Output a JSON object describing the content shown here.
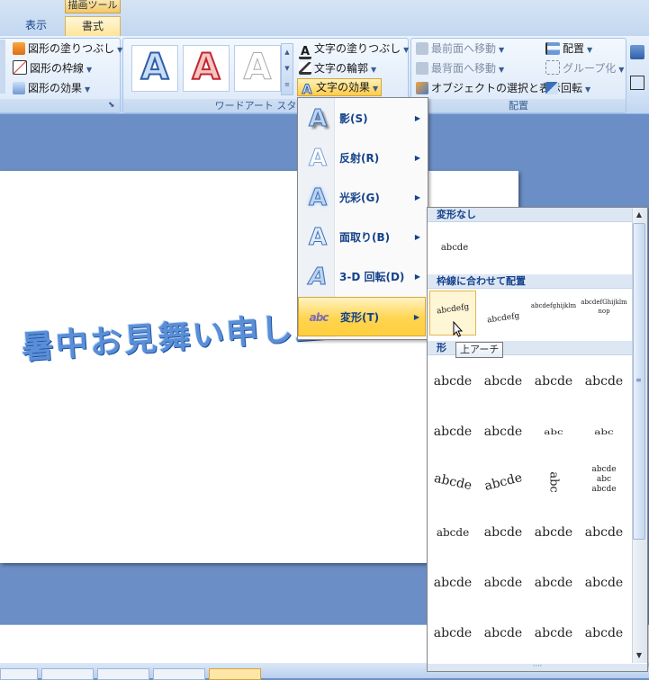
{
  "ribbon": {
    "context_tool_label": "描画ツール",
    "tabs": [
      {
        "label": "表示"
      },
      {
        "label": "書式"
      }
    ],
    "shape_styles": {
      "fill": "図形の塗りつぶし",
      "outline": "図形の枠線",
      "effects": "図形の効果"
    },
    "wordart_styles": {
      "group_label": "ワードアート スタイル",
      "thumb_letter": "A",
      "text_fill": "文字の塗りつぶし",
      "text_outline": "文字の輪郭",
      "text_effects": "文字の効果"
    },
    "arrange": {
      "group_label": "配置",
      "bring_front": "最前面へ移動",
      "send_back": "最背面へ移動",
      "selection_pane": "オブジェクトの選択と表示",
      "align": "配置",
      "group": "グループ化",
      "rotate": "回転"
    }
  },
  "slide": {
    "wordart_text": "暑中お見舞い申し上げ"
  },
  "effects_menu": {
    "items": [
      {
        "label": "影(S)",
        "icon": "shadow-a-icon"
      },
      {
        "label": "反射(R)",
        "icon": "reflection-a-icon"
      },
      {
        "label": "光彩(G)",
        "icon": "glow-a-icon"
      },
      {
        "label": "面取り(B)",
        "icon": "bevel-a-icon"
      },
      {
        "label": "3-D 回転(D)",
        "icon": "3d-rotation-a-icon"
      },
      {
        "label": "変形(T)",
        "icon": "transform-abc-icon"
      }
    ],
    "active_item": "変形(T)"
  },
  "transform_gallery": {
    "sections": {
      "none": "変形なし",
      "follow_path": "枠線に合わせて配置",
      "warp": "形"
    },
    "none_sample": "abcde",
    "follow_path_samples": [
      "abcdefg",
      "abcdefg",
      "abcdefghijklm",
      "abcdefGhijklmnop"
    ],
    "warp_sample": "abcde",
    "warp_circle_samples": [
      "abc",
      "abcde",
      "abc",
      "abcde"
    ],
    "tooltip": "上アーチ"
  },
  "colors": {
    "accent": "#15428b",
    "highlight": "#ffd44f",
    "wordart_blue": "#5a8fd8"
  }
}
